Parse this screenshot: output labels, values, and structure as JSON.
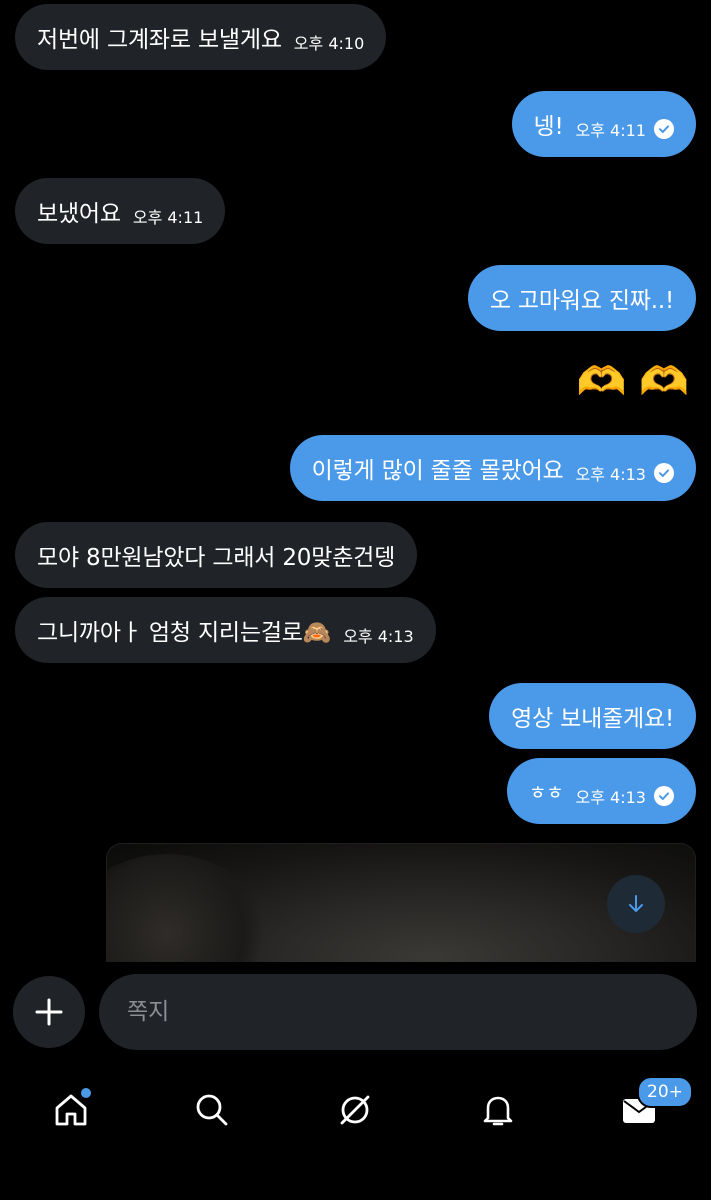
{
  "messages": [
    {
      "text": "저번에 그계좌로 보낼게요",
      "time": "오후 4:10"
    },
    {
      "text": "넹!",
      "time": "오후 4:11"
    },
    {
      "text": "보냈어요",
      "time": "오후 4:11"
    },
    {
      "text": "오 고마워요 진짜..!"
    },
    {
      "emoji": "🫶 🫶"
    },
    {
      "text": "이렇게 많이 줄줄 몰랐어요",
      "time": "오후 4:13"
    },
    {
      "text": "모야 8만원남았다 그래서 20맞춘건뎅"
    },
    {
      "text": "그니까아ㅏ 엄청 지리는걸로🙈",
      "time": "오후 4:13"
    },
    {
      "text": "영상 보내줄게요!"
    },
    {
      "text": "ㅎㅎ",
      "time": "오후 4:13"
    }
  ],
  "composer": {
    "placeholder": "쪽지"
  },
  "nav": {
    "messages_badge": "20+"
  },
  "colors": {
    "accent": "#4b99e9",
    "incoming_bubble": "#202327",
    "background": "#000000"
  },
  "icons": [
    "check-circle-icon",
    "download-icon",
    "plus-icon",
    "home-icon",
    "search-icon",
    "grok-icon",
    "bell-icon",
    "mail-icon"
  ]
}
